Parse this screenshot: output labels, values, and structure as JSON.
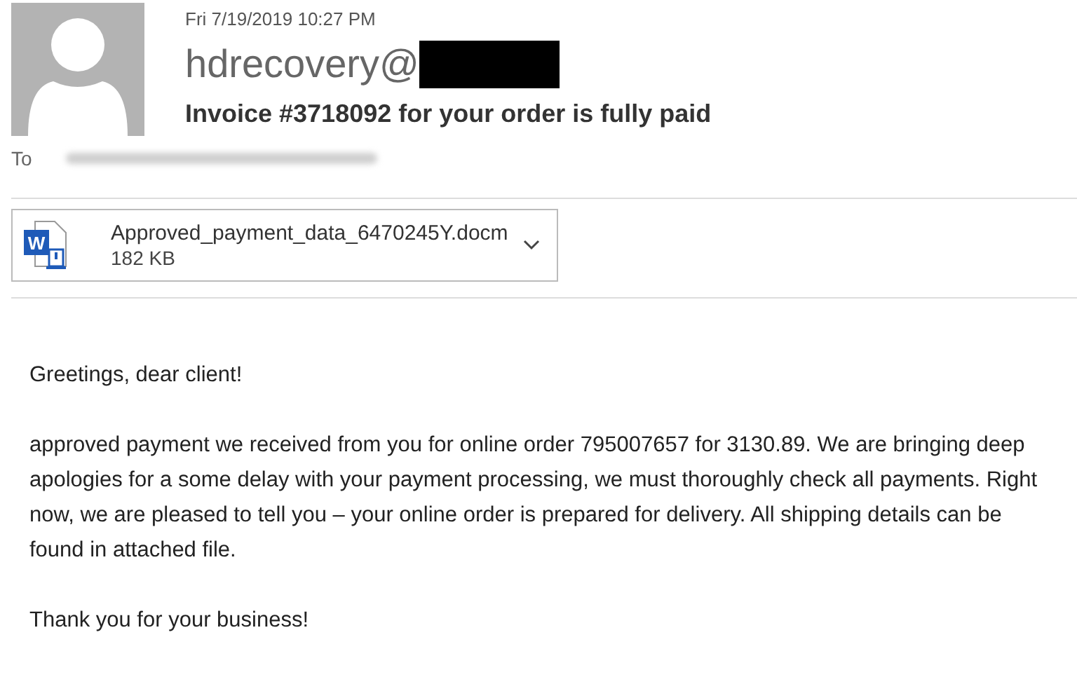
{
  "message": {
    "date": "Fri 7/19/2019 10:27 PM",
    "sender": "hdrecovery@",
    "subject": "Invoice #3718092 for your order is fully paid",
    "to_label": "To"
  },
  "attachment": {
    "icon_letter": "W",
    "filename": "Approved_payment_data_6470245Y.docm",
    "size": "182 KB"
  },
  "body": [
    "Greetings, dear client!",
    "approved payment we received from you for online order 795007657 for 3130.89. We are bringing deep apologies for a some delay with your payment processing, we must thoroughly check all payments. Right now, we are pleased to tell you – your online order is prepared for delivery. All shipping details can be found in attached file.",
    "Thank you for your business!"
  ]
}
